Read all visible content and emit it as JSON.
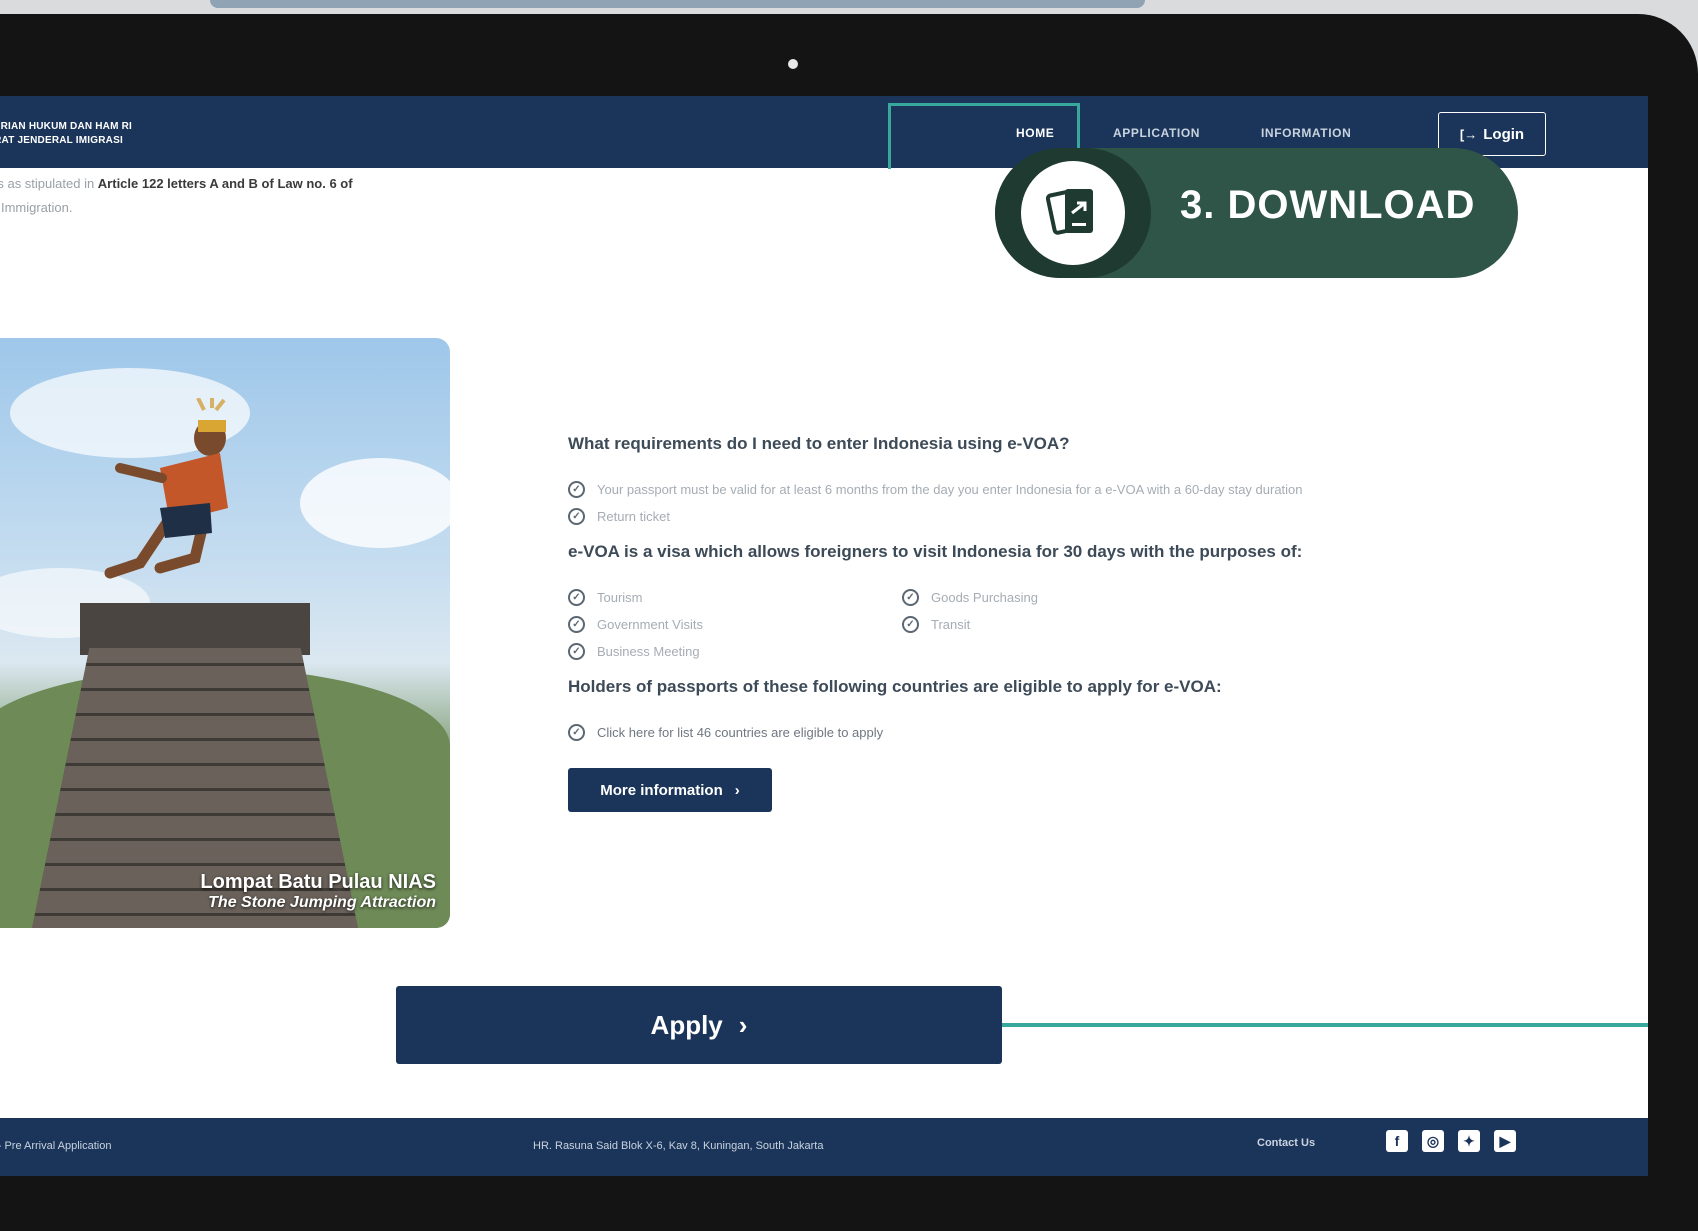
{
  "header": {
    "brand_line1": "NTERIAN HUKUM DAN HAM RI",
    "brand_line2": "TORAT JENDERAL IMIGRASI",
    "nav": {
      "home": "HOME",
      "application": "APPLICATION",
      "information": "INFORMATION"
    },
    "login_label": "Login"
  },
  "intro": {
    "line1_prefix": "ions as stipulated in ",
    "line1_bold": "Article 122 letters A and B of Law no. 6 of",
    "line2": "ing Immigration."
  },
  "download_badge": {
    "label": "3. DOWNLOAD"
  },
  "photo": {
    "caption_title": "Lompat Batu Pulau NIAS",
    "caption_sub": "The Stone Jumping Attraction"
  },
  "requirements": {
    "question": "What requirements do I need to enter Indonesia using e-VOA?",
    "items": [
      "Your passport must be valid for at least 6 months from the day you enter Indonesia for a e-VOA with a 60-day stay duration",
      "Return ticket"
    ]
  },
  "purposes": {
    "question": "e-VOA is a visa which allows foreigners to visit Indonesia for 30 days with the purposes of:",
    "col1": [
      "Tourism",
      "Government Visits",
      "Business Meeting"
    ],
    "col2": [
      "Goods Purchasing",
      "Transit"
    ]
  },
  "countries": {
    "question": "Holders of passports of these following countries are eligible to apply for e-VOA:",
    "link": "Click here for list 46 countries are eligible to apply"
  },
  "more_info_label": "More information",
  "apply_label": "Apply",
  "footer": {
    "left": "ion - Pre Arrival Application",
    "address": "HR. Rasuna Said Blok X-6, Kav 8, Kuningan, South Jakarta",
    "contact": "Contact Us",
    "socials": [
      "facebook-icon",
      "instagram-icon",
      "twitter-icon",
      "youtube-icon"
    ]
  },
  "colors": {
    "navy": "#1b355a",
    "teal_accent": "#38a89d",
    "badge_green": "#2f5448"
  }
}
